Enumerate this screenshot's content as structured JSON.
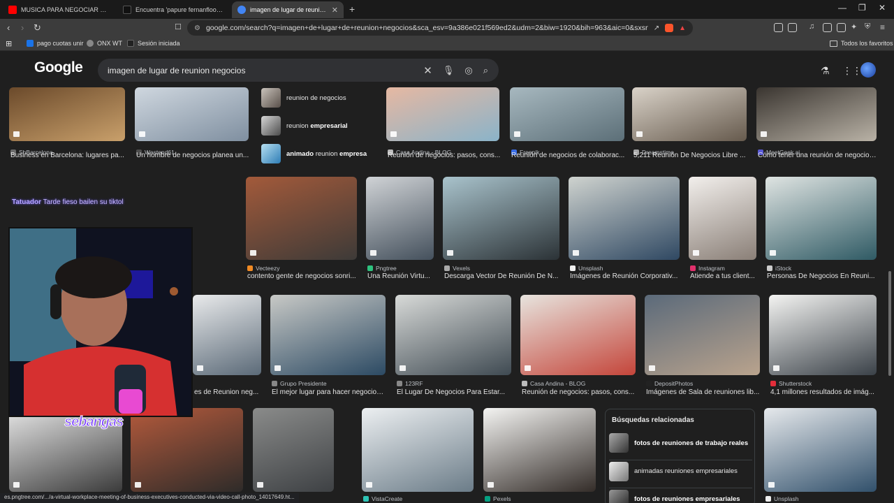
{
  "browser": {
    "tabs": [
      {
        "title": "MUSICA PARA NEGOCIAR #1 | Jazz | ...",
        "favicon_color": "#ff0000",
        "active": false
      },
      {
        "title": "Encuentra 'papure fernanfloo' en Tik...",
        "favicon_color": "#111111",
        "active": false
      },
      {
        "title": "imagen de lugar de reunion neg...",
        "favicon_color": "#4285f4",
        "active": true
      }
    ],
    "new_tab_icon": "plus-icon",
    "url": "google.com/search?q=imagen+de+lugar+de+reunion+negocios&sca_esv=9a386e021f569ed2&udm=2&biw=1920&bih=963&aic=0&sxsrf=ANbL-n...",
    "bookmarks": [
      {
        "label": "pago cuotas unir",
        "favicon_color": "#1a73e8"
      },
      {
        "label": "ONX WT",
        "favicon_color": "#888888"
      },
      {
        "label": "Sesión iniciada",
        "favicon_color": "#222222"
      }
    ],
    "all_favorites": "Todos los favoritos"
  },
  "google": {
    "logo": "Google",
    "query": "imagen de lugar de reunion negocios"
  },
  "related_top": [
    {
      "plain": "reunion de negocios",
      "bold": ""
    },
    {
      "plain": "reunion ",
      "bold": "empresarial"
    },
    {
      "plain": " reunion ",
      "bold": "animado",
      "bold2": "empresa"
    }
  ],
  "related_box": {
    "heading": "Búsquedas relacionadas",
    "items": [
      {
        "text": "fotos de reuniones de trabajo reales"
      },
      {
        "text": "animadas reuniones empresariales"
      },
      {
        "text": "fotos de reuniones empresariales"
      }
    ]
  },
  "results": {
    "row1": [
      {
        "source": "ShBarcelona",
        "caption": "Business en Barcelona: lugares pa...",
        "fav": "#6b6b6b",
        "colors": [
          "#6b4a2b",
          "#c9a06b"
        ]
      },
      {
        "source": "Westend61",
        "caption": "Un hombre de negocios planea un...",
        "fav": "#4d4d4d",
        "colors": [
          "#cfd7df",
          "#7f8fa0"
        ]
      },
      {
        "source": "Casa Andina - BLOG",
        "caption": "Reunión de negocios: pasos, cons...",
        "fav": "#bbbbbb",
        "colors": [
          "#e6b8a2",
          "#8ab3c9"
        ]
      },
      {
        "source": "Freepik",
        "caption": "Reunión de negocios de colaborac...",
        "fav": "#3a6ee8",
        "colors": [
          "#a7b8bf",
          "#5c6f78"
        ]
      },
      {
        "source": "Dreamstime",
        "caption": "5,211 Reunión De Negocios Libre ...",
        "fav": "#aaaaaa",
        "colors": [
          "#d9d2c8",
          "#665a4d"
        ]
      },
      {
        "source": "MeetGeek.ai",
        "caption": "Cómo tener una reunión de negocios...",
        "fav": "#5b5bd6",
        "colors": [
          "#3a3530",
          "#b9b2a6"
        ]
      }
    ],
    "row2": [
      {
        "source": "Vecteezy",
        "caption": "contento gente de negocios sonri...",
        "fav": "#f08a24",
        "colors": [
          "#a35a3a",
          "#3d3a38"
        ]
      },
      {
        "source": "Pngtree",
        "caption": "Una Reunión Virtu...",
        "fav": "#2ec27e",
        "colors": [
          "#d0d3d6",
          "#44505c"
        ]
      },
      {
        "source": "Vexels",
        "caption": "Descarga Vector De Reunión De N...",
        "fav": "#aaaaaa",
        "colors": [
          "#a9c3cc",
          "#2b3236"
        ]
      },
      {
        "source": "Unsplash",
        "caption": "Imágenes de Reunión Corporativ...",
        "fav": "#eeeeee",
        "colors": [
          "#cfd3cf",
          "#2f4862"
        ]
      },
      {
        "source": "Instagram",
        "caption": "Atiende a tus client...",
        "fav": "#e1306c",
        "colors": [
          "#f2efec",
          "#8a7f77"
        ]
      },
      {
        "source": "iStock",
        "caption": "Personas De Negocios En Reuni...",
        "fav": "#cccccc",
        "colors": [
          "#dfe4e2",
          "#2f5a64"
        ]
      }
    ],
    "row3": [
      {
        "source": "",
        "caption": "es de Reunion neg...",
        "fav": "#888888",
        "colors": [
          "#e9eaeb",
          "#5b6a78"
        ]
      },
      {
        "source": "Grupo Presidente",
        "caption": "El mejor lugar para hacer negocios....",
        "fav": "#888888",
        "colors": [
          "#c8c9c6",
          "#2c4a63"
        ]
      },
      {
        "source": "123RF",
        "caption": "El Lugar De Negocios Para Estar...",
        "fav": "#888888",
        "colors": [
          "#d8dad8",
          "#3f4a52"
        ]
      },
      {
        "source": "Casa Andina - BLOG",
        "caption": "Reunión de negocios: pasos, cons...",
        "fav": "#bbbbbb",
        "colors": [
          "#e7e4de",
          "#c4453a"
        ]
      },
      {
        "source": "DepositPhotos",
        "caption": "Imágenes de Sala de reuniones lib...",
        "fav": "#222222",
        "colors": [
          "#5b6a7a",
          "#b9a38d"
        ]
      },
      {
        "source": "Shutterstock",
        "caption": "4,1 millones resultados de imág...",
        "fav": "#e22d3a",
        "colors": [
          "#f4f4f2",
          "#3a4148"
        ]
      }
    ],
    "row4": [
      {
        "source": "",
        "caption": "",
        "fav": "#888888",
        "colors": [
          "#e6e6e6",
          "#3b3b3b"
        ]
      },
      {
        "source": "",
        "caption": "",
        "fav": "#888888",
        "colors": [
          "#b45a3c",
          "#2e2b29"
        ]
      },
      {
        "source": "",
        "caption": "",
        "fav": "#888888",
        "colors": [
          "#8a8b8a",
          "#3e4144"
        ]
      },
      {
        "source": "VistaCreate",
        "caption": "",
        "fav": "#2ec4b6",
        "colors": [
          "#eceff1",
          "#6b7c88"
        ]
      },
      {
        "source": "Pexels",
        "caption": "",
        "fav": "#05a081",
        "colors": [
          "#f4f4f2",
          "#332c28"
        ]
      },
      {
        "source": "Unsplash",
        "caption": "",
        "fav": "#eeeeee",
        "colors": [
          "#e6e9ec",
          "#31506b"
        ]
      }
    ]
  },
  "overlay": {
    "chat_user": "Tatuador",
    "chat_message": "Tarde fieso bailen su tiktol",
    "brand": "sebangas"
  },
  "status_url": "es.pngtree.com/.../a-virtual-workplace-meeting-of-business-executives-conducted-via-video-call-photo_14017649.ht..."
}
